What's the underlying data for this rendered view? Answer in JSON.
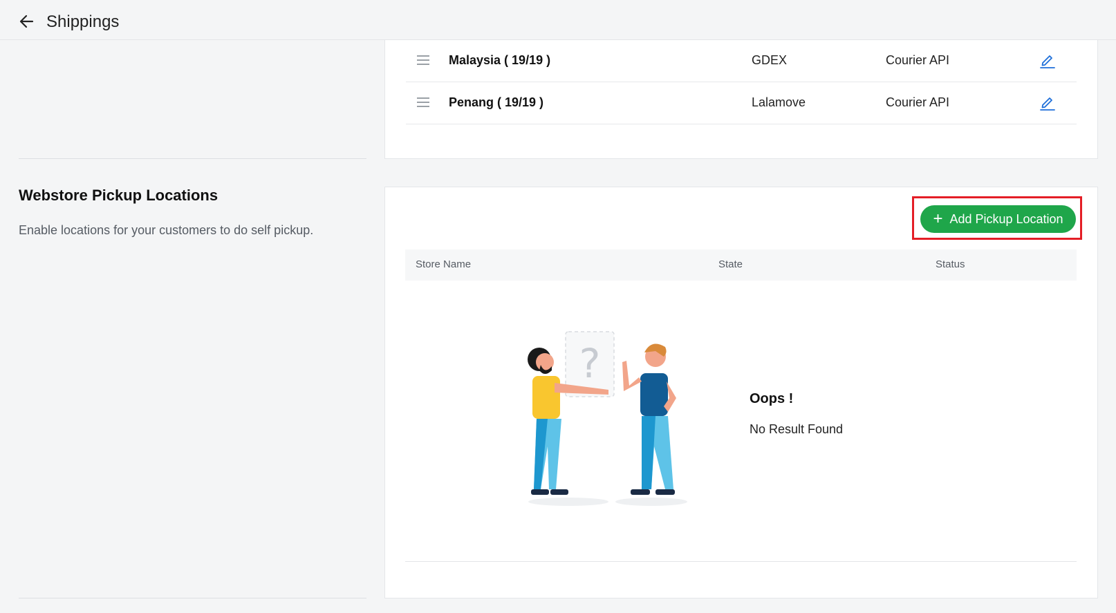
{
  "header": {
    "title": "Shippings",
    "back_icon": "arrow-left-icon"
  },
  "shipping_zones": [
    {
      "name": "Malaysia ( 19/19 )",
      "provider": "GDEX",
      "method": "Courier API"
    },
    {
      "name": "Penang ( 19/19 )",
      "provider": "Lalamove",
      "method": "Courier API"
    }
  ],
  "pickup_section": {
    "title": "Webstore Pickup Locations",
    "description": "Enable locations for your customers to do self pickup.",
    "add_button_label": "Add Pickup Location",
    "table_headers": {
      "store_name": "Store Name",
      "state": "State",
      "status": "Status"
    },
    "empty_state": {
      "title": "Oops !",
      "message": "No Result Found"
    }
  },
  "colors": {
    "accent_green": "#1fa64a",
    "highlight_red": "#e41e26",
    "edit_blue": "#1e6fd9"
  }
}
